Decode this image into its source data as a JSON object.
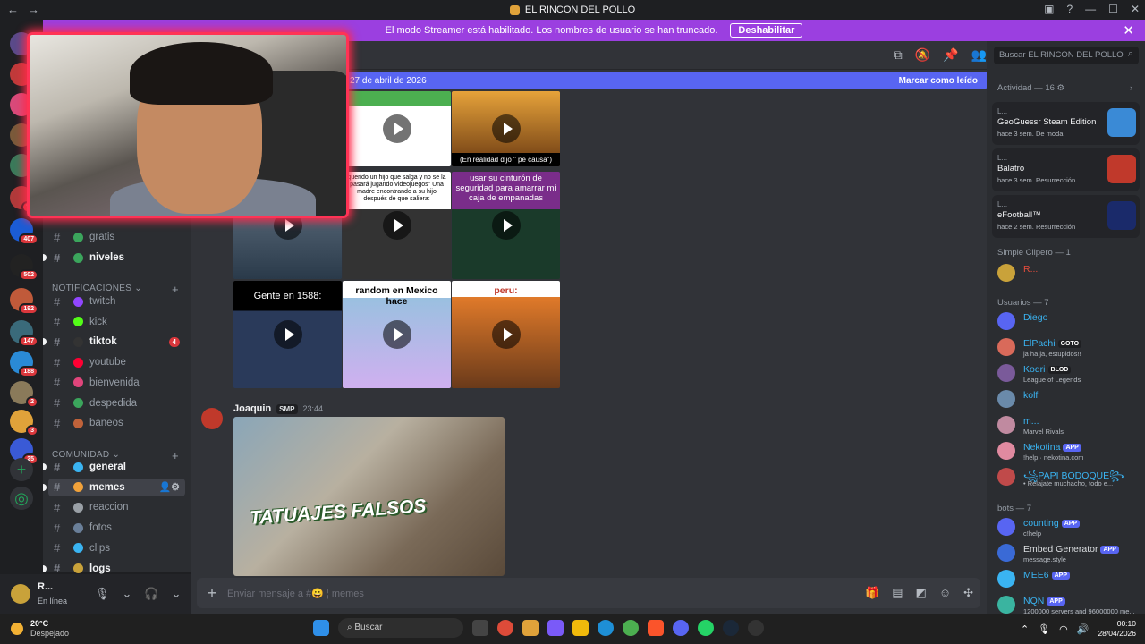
{
  "window": {
    "title": "EL RINCON DEL POLLO",
    "back": "←",
    "forward": "→"
  },
  "banner": {
    "text": "El modo Streamer está habilitado. Los nombres de usuario se han truncado.",
    "button": "Deshabilitar"
  },
  "guilds": [
    {
      "badge": ""
    },
    {
      "badge": ""
    },
    {
      "badge": ""
    },
    {
      "badge": ""
    },
    {
      "badge": ""
    },
    {
      "badge": "1K"
    },
    {
      "badge": "407"
    },
    {
      "badge": "502"
    },
    {
      "badge": "192"
    },
    {
      "badge": "147"
    },
    {
      "badge": "188"
    },
    {
      "badge": "2"
    },
    {
      "badge": "3"
    },
    {
      "badge": "25"
    }
  ],
  "channels": {
    "top": [
      {
        "name": "gratis",
        "bold": false
      },
      {
        "name": "niveles",
        "bold": true
      }
    ],
    "notificaciones": {
      "label": "NOTIFICACIONES",
      "items": [
        {
          "name": "twitch",
          "bold": false,
          "color": "#9146ff"
        },
        {
          "name": "kick",
          "bold": false,
          "color": "#53fc18"
        },
        {
          "name": "tiktok",
          "bold": true,
          "color": "#333333",
          "mention": "4"
        },
        {
          "name": "youtube",
          "bold": false,
          "color": "#ff0033"
        },
        {
          "name": "bienvenida",
          "bold": false,
          "color": "#e0457b"
        },
        {
          "name": "despedida",
          "bold": false,
          "color": "#3ba55c"
        },
        {
          "name": "baneos",
          "bold": false,
          "color": "#c0623a"
        }
      ]
    },
    "comunidad": {
      "label": "COMUNIDAD",
      "items": [
        {
          "name": "general",
          "bold": true,
          "color": "#3ab4f2"
        },
        {
          "name": "memes",
          "bold": true,
          "color": "#f2a23a",
          "active": true
        },
        {
          "name": "reaccion",
          "bold": false,
          "color": "#9aa0a6"
        },
        {
          "name": "fotos",
          "bold": false,
          "color": "#6a7f99"
        },
        {
          "name": "clips",
          "bold": false,
          "color": "#3ab4f2"
        },
        {
          "name": "logs",
          "bold": true,
          "color": "#c9a23a"
        }
      ]
    }
  },
  "user": {
    "name": "R...",
    "status": "En línea"
  },
  "chat": {
    "new_messages": "27 de abril de 2026",
    "mark_read": "Marcar como leído",
    "tiles": [
      {
        "caption": ""
      },
      {
        "caption": "(En realidad dijo \" pe causa\")"
      },
      {
        "caption": "querido un hijo que salga y no se la pasará jugando videojuegos\" Una madre encontrando a su hijo después de que saliera:"
      },
      {
        "caption": "usar su cinturón de seguridad para amarrar mi caja de empanadas"
      },
      {
        "caption": "Gente en 1588:"
      },
      {
        "caption": "random en Mexico hace"
      },
      {
        "caption": "peru:"
      }
    ],
    "message": {
      "author": "Joaquin",
      "tag": "SMP",
      "time": "23:44",
      "embed_caption": "TATUAJES FALSOS"
    },
    "composer_placeholder": "Enviar mensaje a #",
    "composer_channel": "memes"
  },
  "members": {
    "search": "Buscar EL RINCON DEL POLLO",
    "activity_label": "Actividad — 16",
    "activities": [
      {
        "user": "L...",
        "game": "GeoGuessr Steam Edition",
        "status": "hace 3 sem.   De moda"
      },
      {
        "user": "L...",
        "game": "Balatro",
        "status": "hace 3 sem.   Resurrección"
      },
      {
        "user": "L...",
        "game": "eFootball™",
        "status": "hace 2 sem.   Resurrección"
      }
    ],
    "group1": {
      "label": "Simple Clipero — 1",
      "members": [
        {
          "name": "R...",
          "status": "",
          "color": "#e74c3c"
        }
      ]
    },
    "group2": {
      "label": "Usuarios — 7",
      "members": [
        {
          "name": "Diego",
          "status": "",
          "color": "#3ab4f2",
          "tag": ""
        },
        {
          "name": "ElPachi",
          "status": "ja ha ja, estupidos!!",
          "color": "#3ab4f2",
          "tag": "GOTO"
        },
        {
          "name": "Kodri",
          "status": "League of Legends",
          "color": "#3ab4f2",
          "tag": "BLOD"
        },
        {
          "name": "kolf",
          "status": "",
          "color": "#3ab4f2",
          "tag": ""
        },
        {
          "name": "m...",
          "status": "Marvel Rivals",
          "color": "#3ab4f2",
          "tag": ""
        },
        {
          "name": "Nekotina",
          "status": "!help · nekotina.com",
          "color": "#3ab4f2",
          "app": "APP"
        },
        {
          "name": "꧁PAPI BODOQUE꧂",
          "status": "• Relajate muchacho, todo e...",
          "color": "#3ab4f2",
          "tag": ""
        }
      ]
    },
    "group3": {
      "label": "bots — 7",
      "members": [
        {
          "name": "counting",
          "status": "c!help",
          "color": "#3ab4f2",
          "app": "APP"
        },
        {
          "name": "Embed Generator",
          "status": "message.style",
          "color": "#dbdee1",
          "app": "APP"
        },
        {
          "name": "MEE6",
          "status": "",
          "color": "#3ab4f2",
          "app": "APP"
        },
        {
          "name": "NQN",
          "status": "1200000 servers and 96000000 me...",
          "color": "#3ab4f2",
          "app": "APP"
        }
      ]
    }
  },
  "taskbar": {
    "temp": "20°C",
    "weather": "Despejado",
    "search": "Buscar",
    "time": "00:10",
    "date": "28/04/2026"
  }
}
